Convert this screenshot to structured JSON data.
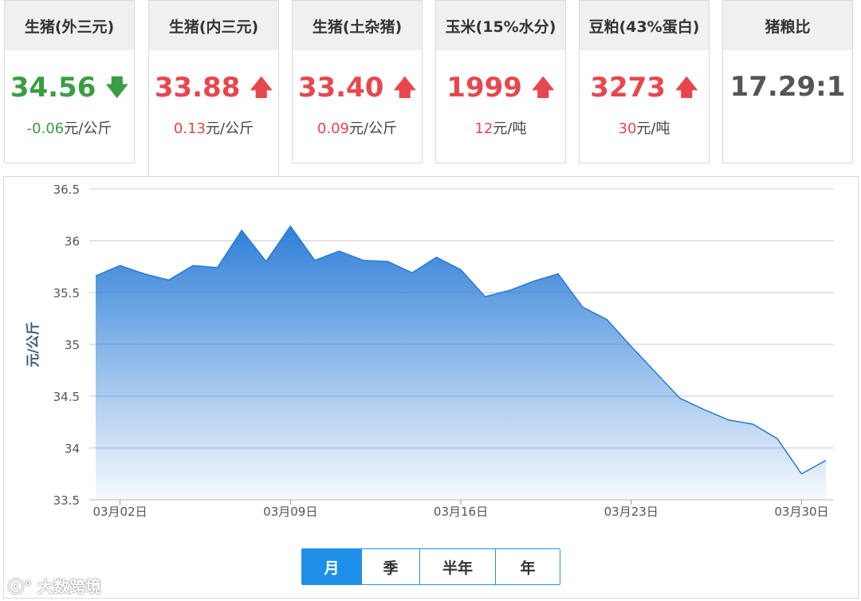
{
  "cards": [
    {
      "title": "生猪(外三元)",
      "value": "34.56",
      "change": "-0.06",
      "unit": "元/公斤",
      "direction": "down"
    },
    {
      "title": "生猪(内三元)",
      "value": "33.88",
      "change": "0.13",
      "unit": "元/公斤",
      "direction": "up"
    },
    {
      "title": "生猪(土杂猪)",
      "value": "33.40",
      "change": "0.09",
      "unit": "元/公斤",
      "direction": "up"
    },
    {
      "title": "玉米(15%水分)",
      "value": "1999",
      "change": "12",
      "unit": "元/吨",
      "direction": "up"
    },
    {
      "title": "豆粕(43%蛋白)",
      "value": "3273",
      "change": "30",
      "unit": "元/吨",
      "direction": "up"
    },
    {
      "title": "猪粮比",
      "value": "17.29:1",
      "change": "",
      "unit": "",
      "direction": "none"
    }
  ],
  "colors": {
    "up": "#e8464e",
    "down": "#3a9d43",
    "accent": "#1e8fe8",
    "area_top": "#2f7fd8"
  },
  "period_buttons": [
    "月",
    "季",
    "半年",
    "年"
  ],
  "selected_period": "月",
  "watermark": "大数跨境",
  "chart_data": {
    "type": "area",
    "ylabel": "元/公斤",
    "ylim": [
      33.5,
      36.5
    ],
    "yticks": [
      "36.5",
      "36",
      "35.5",
      "35",
      "34.5",
      "34",
      "33.5"
    ],
    "xticks": [
      "03月02日",
      "03月09日",
      "03月16日",
      "03月23日",
      "03月30日"
    ],
    "x": [
      "03月01日",
      "03月02日",
      "03月03日",
      "03月04日",
      "03月05日",
      "03月06日",
      "03月07日",
      "03月08日",
      "03月09日",
      "03月10日",
      "03月11日",
      "03月12日",
      "03月13日",
      "03月14日",
      "03月15日",
      "03月16日",
      "03月17日",
      "03月18日",
      "03月19日",
      "03月20日",
      "03月21日",
      "03月22日",
      "03月23日",
      "03月24日",
      "03月25日",
      "03月26日",
      "03月27日",
      "03月28日",
      "03月29日",
      "03月30日"
    ],
    "values": [
      35.66,
      35.76,
      35.68,
      35.62,
      35.76,
      35.74,
      36.1,
      35.8,
      36.14,
      35.81,
      35.9,
      35.81,
      35.8,
      35.69,
      35.84,
      35.72,
      35.46,
      35.52,
      35.61,
      35.68,
      35.36,
      35.24,
      34.98,
      34.73,
      34.48,
      34.37,
      34.27,
      34.23,
      34.09,
      33.75,
      33.88
    ],
    "grid": true
  }
}
